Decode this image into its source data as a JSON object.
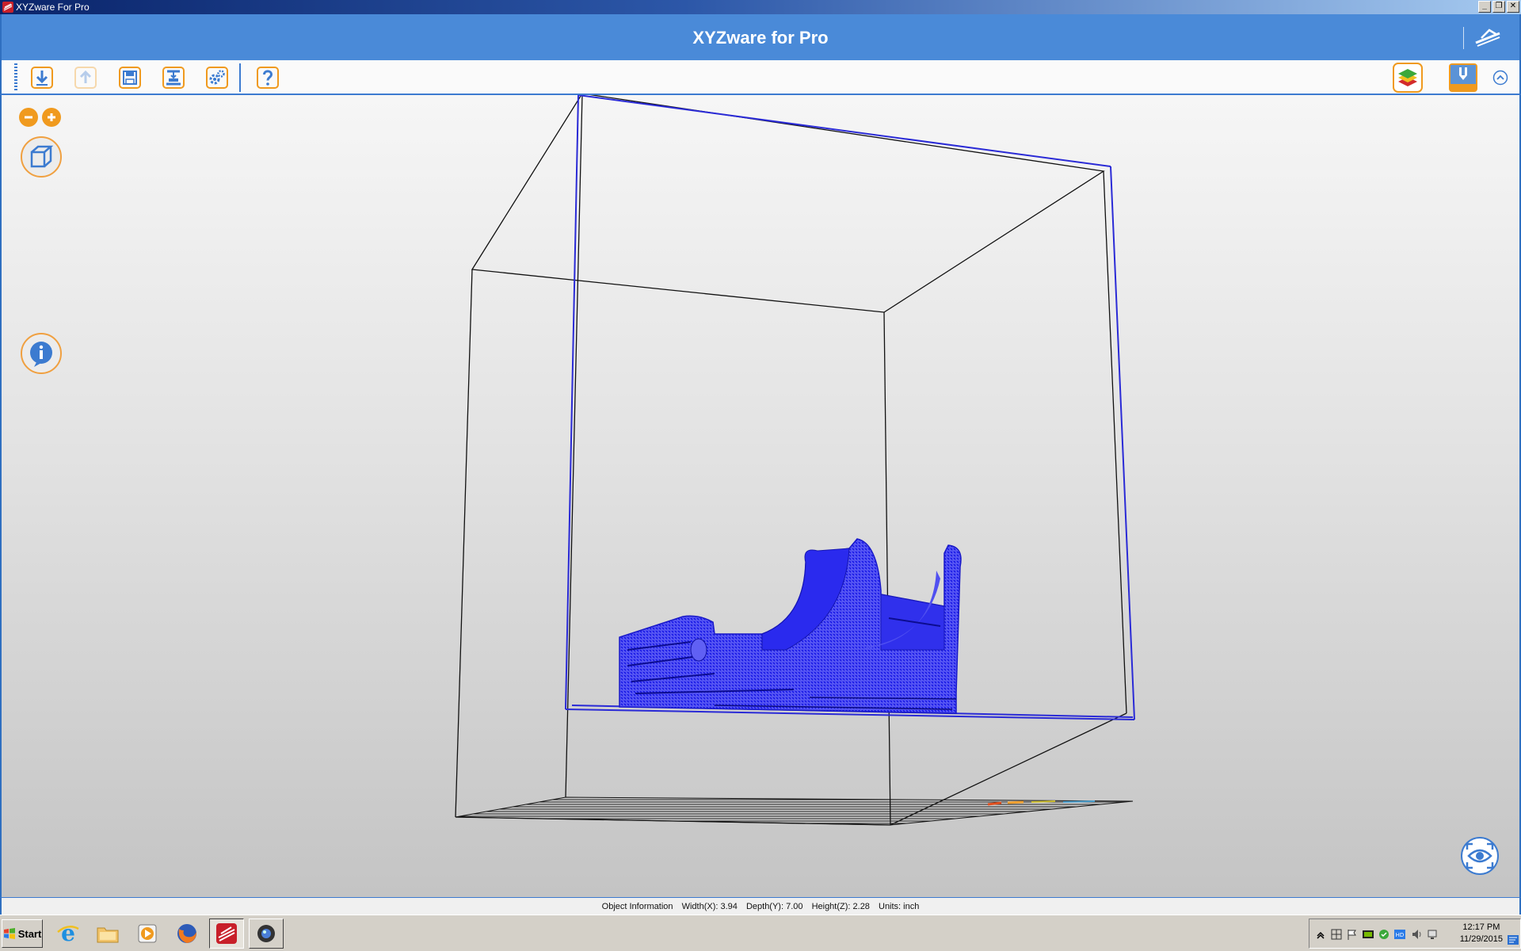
{
  "window": {
    "title": "XYZware For Pro",
    "controls": [
      "minimize",
      "restore",
      "close"
    ]
  },
  "header": {
    "title": "XYZware for Pro",
    "logo_icon": "xyz-logo-icon"
  },
  "toolbar": {
    "buttons": [
      {
        "name": "import-button",
        "icon": "import-arrow-icon",
        "enabled": true
      },
      {
        "name": "export-button",
        "icon": "export-arrow-icon",
        "enabled": false
      },
      {
        "name": "save-button",
        "icon": "floppy-disk-icon",
        "enabled": true
      },
      {
        "name": "print-button",
        "icon": "printer-icon",
        "enabled": true
      },
      {
        "name": "settings-button",
        "icon": "gears-icon",
        "enabled": true
      },
      {
        "name": "help-button",
        "icon": "question-mark-icon",
        "enabled": true
      }
    ],
    "right_buttons": [
      {
        "name": "layers-button",
        "icon": "layers-icon"
      },
      {
        "name": "printer-model-button",
        "icon": "printer-model-icon"
      },
      {
        "name": "collapse-button",
        "icon": "chevron-up-icon"
      }
    ]
  },
  "viewport": {
    "zoom_out_icon": "minus-icon",
    "zoom_in_icon": "plus-icon",
    "view_cube_icon": "cube-icon",
    "info_icon": "info-icon",
    "camera_icon": "eye-icon",
    "model_color": "#1e1ee6",
    "box_color": "#000000",
    "selection_color": "#2a2ad6"
  },
  "status": {
    "label": "Object Information",
    "width": "Width(X): 3.94",
    "depth": "Depth(Y): 7.00",
    "height": "Height(Z): 2.28",
    "units": "Units: inch"
  },
  "taskbar": {
    "start_label": "Start",
    "apps": [
      {
        "name": "internet-explorer",
        "icon": "ie-icon"
      },
      {
        "name": "file-explorer",
        "icon": "folder-icon"
      },
      {
        "name": "media-player",
        "icon": "media-play-icon"
      },
      {
        "name": "firefox",
        "icon": "firefox-icon"
      },
      {
        "name": "xyzware",
        "icon": "xyzware-icon",
        "active": true
      },
      {
        "name": "camera-app",
        "icon": "camera-icon"
      }
    ],
    "clock_time": "12:17 PM",
    "clock_date": "11/29/2015"
  },
  "colors": {
    "header_blue": "#4a8ad8",
    "accent_orange": "#f09a1e",
    "toolbar_blue": "#3c7bd0"
  }
}
